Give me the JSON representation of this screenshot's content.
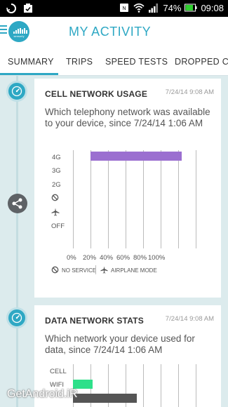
{
  "status_bar": {
    "battery": "74%",
    "time": "09:08"
  },
  "app": {
    "title": "MY ACTIVITY",
    "logo_text": "sensorly"
  },
  "tabs": [
    {
      "label": "SUMMARY",
      "active": true
    },
    {
      "label": "TRIPS"
    },
    {
      "label": "SPEED TESTS"
    },
    {
      "label": "DROPPED CA"
    }
  ],
  "cards": [
    {
      "title": "CELL NETWORK USAGE",
      "timestamp": "7/24/14 9:08 AM",
      "description": "Which telephony network was available to your device, since 7/24/14 1:06 AM",
      "chart_data": {
        "type": "bar",
        "orientation": "horizontal",
        "categories": [
          "4G",
          "3G",
          "2G",
          "no-service",
          "airplane-mode",
          "OFF"
        ],
        "values": [
          100,
          0,
          0,
          0,
          0,
          0
        ],
        "xlim": [
          0,
          100
        ],
        "x_ticks": [
          "0%",
          "20%",
          "40%",
          "60%",
          "80%",
          "100%"
        ],
        "bar_color": "#9b6fd0",
        "legend": [
          "NO SERVICE",
          "AIRPLANE MODE"
        ]
      }
    },
    {
      "title": "DATA NETWORK STATS",
      "timestamp": "7/24/14 9:08 AM",
      "description": "Which network your device used for data, since 7/24/14 1:06 AM",
      "chart_data": {
        "type": "bar",
        "orientation": "horizontal",
        "categories": [
          "CELL",
          "WIFI",
          ""
        ],
        "values": [
          0,
          16,
          52
        ],
        "xlim": [
          0,
          100
        ],
        "bar_colors": [
          "#2ee08a",
          "#2ee08a",
          "#555555"
        ]
      }
    }
  ],
  "watermark": "GetAndroid.iR",
  "colors": {
    "accent": "#2ea8c4",
    "background": "#dcebed"
  }
}
